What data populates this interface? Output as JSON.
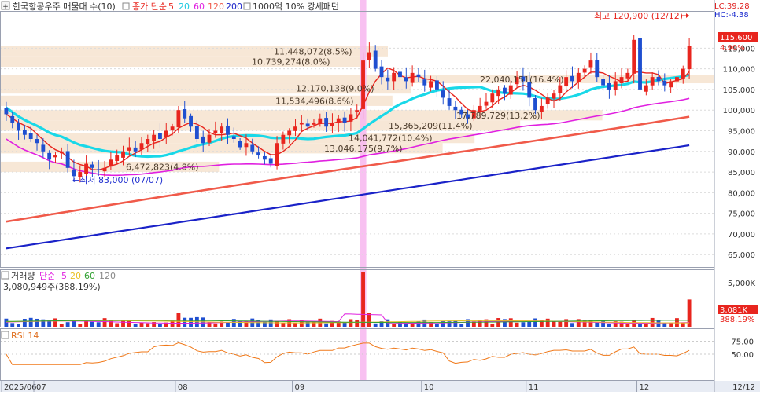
{
  "header": {
    "title": "한국항공우주 매물대 수(10)",
    "ma_label": "종가 단순",
    "ma_periods": [
      "5",
      "20",
      "60",
      "120",
      "200"
    ],
    "ma_colors": [
      "#e8251e",
      "#18d8e8",
      "#e020e0",
      "#f05a4a",
      "#1a22c8"
    ],
    "pattern_label": "1000억 10% 강세패턴",
    "lc": "LC:39.28",
    "hc": "HC:-4.38"
  },
  "price_badge": {
    "value": "115,600",
    "change": "4.90%"
  },
  "annotations": {
    "high": "최고 120,900 (12/12)",
    "low": "←최저 83,000 (07/07)"
  },
  "volume_header": {
    "label": "거래량",
    "ma_label": "단순",
    "ma_periods": [
      "5",
      "20",
      "60",
      "120"
    ],
    "value": "3,080,949주(388.19%)",
    "badge_value": "3,081K",
    "badge_pct": "388.19%"
  },
  "rsi_header": {
    "label": "RSI 14"
  },
  "chart_data": {
    "type": "candlestick",
    "price_axis": {
      "range": [
        62000,
        124000
      ],
      "ticks": [
        65000,
        70000,
        75000,
        80000,
        85000,
        90000,
        95000,
        100000,
        105000,
        110000,
        115000
      ],
      "tick_labels": [
        "65,000",
        "70,000",
        "75,000",
        "80,000",
        "85,000",
        "90,000",
        "95,000",
        "100,000",
        "105,000",
        "110,000",
        "115,000"
      ]
    },
    "volume_axis": {
      "range": [
        0,
        6500000
      ],
      "ticks": [
        5000000
      ],
      "tick_labels": [
        "5,000K"
      ]
    },
    "rsi_axis": {
      "range": [
        0,
        100
      ],
      "ticks": [
        75,
        50
      ],
      "tick_labels": [
        "75.00",
        "50.00"
      ]
    },
    "x_axis": {
      "labels": [
        {
          "label": "2025/06",
          "index": 0
        },
        {
          "label": "07",
          "index": 5
        },
        {
          "label": "08",
          "index": 28
        },
        {
          "label": "09",
          "index": 47
        },
        {
          "label": "10",
          "index": 68
        },
        {
          "label": "11",
          "index": 85
        },
        {
          "label": "12",
          "index": 103
        }
      ],
      "end_label": "12/12"
    },
    "highlight_index": 58,
    "volume_profile": [
      {
        "label": "11,448,072(8.5%)",
        "lo": 113000,
        "hi": 115500
      },
      {
        "label": "10,739,274(8.0%)",
        "lo": 110500,
        "hi": 113000
      },
      {
        "label": "12,170,138(9.0%)",
        "lo": 104000,
        "hi": 106500
      },
      {
        "label": "11,534,496(8.6%)",
        "lo": 101000,
        "hi": 103500
      },
      {
        "label": "22,040,151(16.4%)",
        "lo": 106500,
        "hi": 108500
      },
      {
        "label": "17,789,729(13.2%)",
        "lo": 97500,
        "hi": 100000
      },
      {
        "label": "15,365,209(11.4%)",
        "lo": 95000,
        "hi": 97500
      },
      {
        "label": "14,041,772(10.4%)",
        "lo": 92000,
        "hi": 94500
      },
      {
        "label": "13,046,175(9.7%)",
        "lo": 89500,
        "hi": 92000
      },
      {
        "label": "6,472,823(4.8%)",
        "lo": 85000,
        "hi": 87500
      }
    ],
    "closes": [
      99000,
      97000,
      95000,
      94000,
      93000,
      92000,
      90000,
      88000,
      89000,
      90000,
      86000,
      84000,
      85000,
      87000,
      86000,
      85500,
      86000,
      88000,
      89000,
      90000,
      91000,
      90000,
      92000,
      93000,
      94000,
      93000,
      95000,
      96000,
      100000,
      98000,
      96000,
      93000,
      92000,
      94000,
      95000,
      96000,
      94000,
      93000,
      91000,
      92000,
      90000,
      89000,
      88000,
      87000,
      92000,
      94000,
      95000,
      96000,
      97000,
      96000,
      97000,
      98000,
      96000,
      97000,
      98000,
      97000,
      99000,
      100000,
      112000,
      114000,
      110000,
      108000,
      107000,
      109000,
      108000,
      107000,
      109000,
      108000,
      106000,
      107000,
      105000,
      103000,
      101000,
      100000,
      99000,
      98000,
      100000,
      101000,
      102000,
      104000,
      105000,
      104000,
      106000,
      108000,
      107000,
      103000,
      100000,
      101000,
      103000,
      104000,
      106000,
      108000,
      107000,
      109000,
      110000,
      112000,
      108000,
      106000,
      105000,
      107000,
      108000,
      109000,
      117000,
      105000,
      106000,
      108000,
      107000,
      106000,
      107000,
      108000,
      110000,
      115600
    ],
    "ma_series": [
      {
        "name": "5",
        "values": []
      },
      {
        "name": "20",
        "values": []
      },
      {
        "name": "60",
        "values": []
      },
      {
        "name": "120",
        "values": []
      },
      {
        "name": "200",
        "values": []
      }
    ]
  }
}
